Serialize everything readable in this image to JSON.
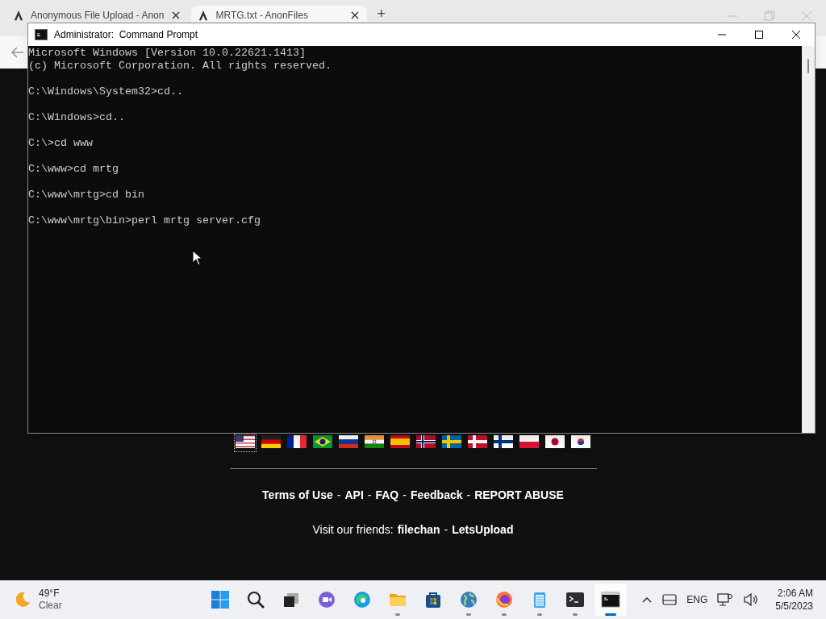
{
  "browser": {
    "tabs": [
      {
        "title": "Anonymous File Upload - Anon",
        "selected": false
      },
      {
        "title": "MRTG.txt - AnonFiles",
        "selected": true
      }
    ],
    "new_tab": "+",
    "page": {
      "flags": [
        {
          "kind": "us",
          "selected": true
        },
        {
          "kind": "de",
          "selected": false
        },
        {
          "kind": "fr",
          "selected": false
        },
        {
          "kind": "br",
          "selected": false
        },
        {
          "kind": "ru",
          "selected": false
        },
        {
          "kind": "in",
          "selected": false
        },
        {
          "kind": "es",
          "selected": false
        },
        {
          "kind": "no",
          "selected": false
        },
        {
          "kind": "se",
          "selected": false
        },
        {
          "kind": "dk",
          "selected": false
        },
        {
          "kind": "fi",
          "selected": false
        },
        {
          "kind": "pl",
          "selected": false
        },
        {
          "kind": "jp",
          "selected": false
        },
        {
          "kind": "kr",
          "selected": false
        }
      ],
      "separator": "-",
      "links": [
        "Terms of Use",
        "API",
        "FAQ",
        "Feedback",
        "REPORT ABUSE"
      ],
      "friends_label": "Visit our friends:",
      "friends": [
        "filechan",
        "LetsUpload"
      ]
    }
  },
  "console": {
    "title": "Administrator:  Command Prompt",
    "blocks": [
      [
        "Microsoft Windows [Version 10.0.22621.1413]",
        "(c) Microsoft Corporation. All rights reserved."
      ],
      [
        "C:\\Windows\\System32>cd.."
      ],
      [
        "C:\\Windows>cd.."
      ],
      [
        "C:\\>cd www"
      ],
      [
        "C:\\www>cd mrtg"
      ],
      [
        "C:\\www\\mrtg>cd bin"
      ],
      [
        "C:\\www\\mrtg\\bin>perl mrtg server.cfg"
      ]
    ]
  },
  "taskbar": {
    "weather": {
      "temp": "49°F",
      "condition": "Clear"
    },
    "apps": [
      {
        "kind": "start",
        "running": false,
        "selected": false
      },
      {
        "kind": "search",
        "running": false,
        "selected": false
      },
      {
        "kind": "taskview",
        "running": false,
        "selected": false
      },
      {
        "kind": "chat",
        "running": false,
        "selected": false
      },
      {
        "kind": "edge",
        "running": false,
        "selected": false
      },
      {
        "kind": "explorer",
        "running": true,
        "selected": false
      },
      {
        "kind": "store",
        "running": false,
        "selected": false
      },
      {
        "kind": "globe",
        "running": true,
        "selected": false
      },
      {
        "kind": "firefox",
        "running": true,
        "selected": false
      },
      {
        "kind": "notepad",
        "running": true,
        "selected": false
      },
      {
        "kind": "terminal",
        "running": true,
        "selected": false
      },
      {
        "kind": "cmd",
        "running": true,
        "selected": true
      }
    ],
    "language": "ENG",
    "time": "2:06 AM",
    "date": "5/5/2023"
  }
}
